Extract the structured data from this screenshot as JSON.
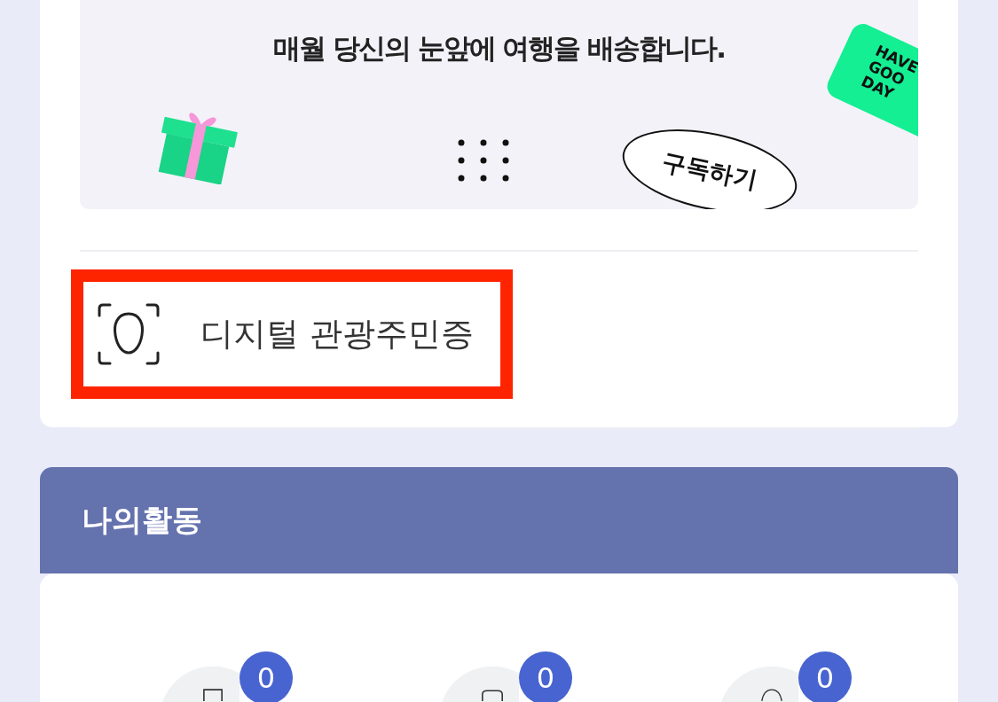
{
  "banner": {
    "headline": "매월 당신의 눈앞에 여행을 배송합니다.",
    "subscribe_label": "구독하기",
    "sticker_lines": [
      "HAVE",
      "GOO",
      "DAY"
    ]
  },
  "menu_item": {
    "label": "디지털 관광주민증",
    "highlighted": true
  },
  "activity": {
    "title": "나의활동",
    "items": [
      {
        "kind": "document",
        "badge": "0"
      },
      {
        "kind": "ticket",
        "badge": "0"
      },
      {
        "kind": "profile",
        "badge": "0"
      }
    ]
  }
}
